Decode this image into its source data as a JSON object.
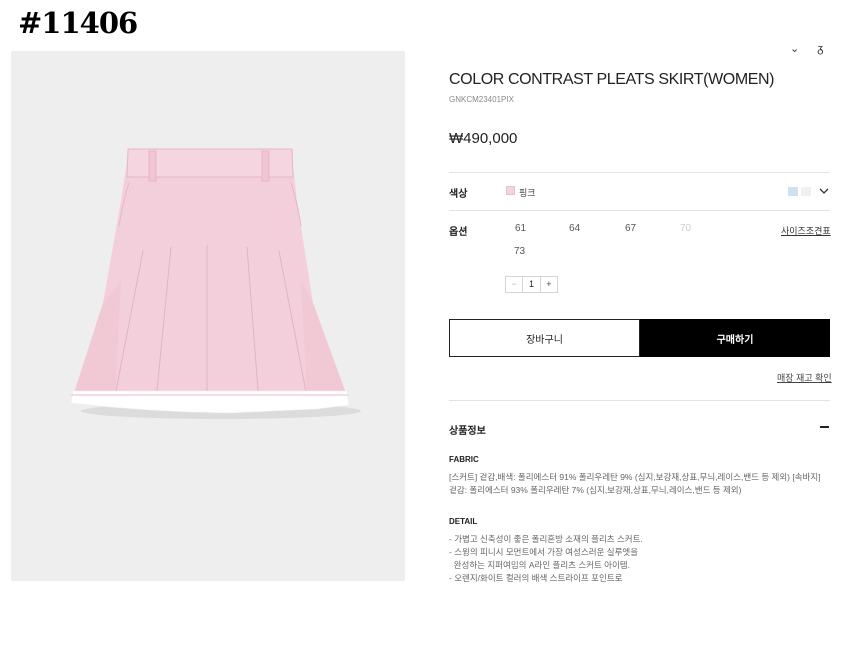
{
  "post_tag": "#11406",
  "product": {
    "title": "COLOR CONTRAST PLEATS SKIRT(WOMEN)",
    "sku": "GNKCM23401PIX",
    "price": "₩490,000"
  },
  "color_row": {
    "label": "색상",
    "selected": "핑크",
    "selected_hex": "#f5d3dc",
    "other_swatches": [
      "#cfe0f2",
      "#f0f0f0"
    ]
  },
  "option_row": {
    "label": "옵션",
    "sizes": [
      {
        "value": "61",
        "available": true
      },
      {
        "value": "64",
        "available": true
      },
      {
        "value": "67",
        "available": true
      },
      {
        "value": "70",
        "available": false
      },
      {
        "value": "73",
        "available": true
      }
    ],
    "size_chart_link": "사이즈조견표"
  },
  "quantity": {
    "minus": "−",
    "value": "1",
    "plus": "+"
  },
  "actions": {
    "cart": "장바구니",
    "buy": "구매하기",
    "store_stock": "매장 재고 확인"
  },
  "info": {
    "header": "상품정보",
    "fabric_label": "FABRIC",
    "fabric_lines": [
      "[스커트] 겉감,배색: 폴리에스터 91% 폴리우레탄 9% (심지,보강재,상표,무늬,레이스,밴드 등 제외) [속바지]",
      "겉감: 폴리에스터 93% 폴리우레탄 7% (심지,보강재,상표,무늬,레이스,밴드 등 제외)"
    ],
    "detail_label": "DETAIL",
    "detail_lines": [
      "- 가볍고 신축성이 좋은 폴리혼방 소재의 플리츠 스커트.",
      "- 스윙의 피니시 모먼트에서 가장 여성스러운 실루엣을",
      "  완성하는 지퍼여밈의 A라인 플리츠 스커트 아이템.",
      "- 오렌지/화이트 컬러의 배색 스트라이프 포인트로"
    ]
  },
  "colors": {
    "accent": "#000000",
    "image_bg": "#eeeeee",
    "skirt_pink": "#f3cfdb"
  }
}
